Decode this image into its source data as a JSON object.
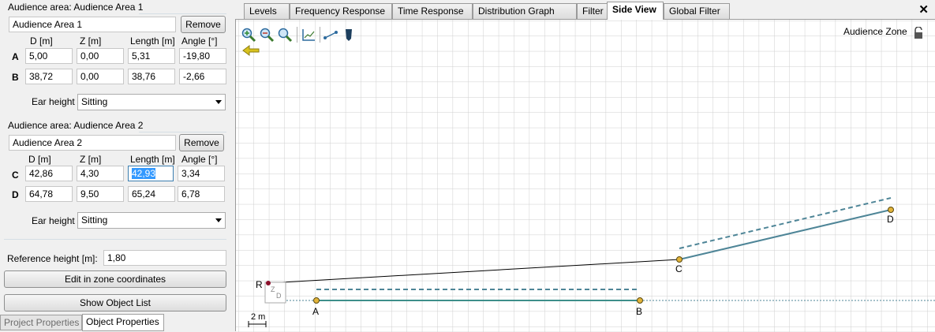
{
  "area1": {
    "title": "Audience area: Audience Area 1",
    "name": "Audience Area 1",
    "remove_label": "Remove",
    "columns": [
      "D [m]",
      "Z [m]",
      "Length [m]",
      "Angle [°]"
    ],
    "rows": [
      {
        "label": "A",
        "d": "5,00",
        "z": "0,00",
        "length": "5,31",
        "angle": "-19,80"
      },
      {
        "label": "B",
        "d": "38,72",
        "z": "0,00",
        "length": "38,76",
        "angle": "-2,66"
      }
    ],
    "ear_height_label": "Ear height",
    "ear_height_value": "Sitting"
  },
  "area2": {
    "title": "Audience area: Audience Area 2",
    "name": "Audience Area 2",
    "remove_label": "Remove",
    "columns": [
      "D [m]",
      "Z [m]",
      "Length [m]",
      "Angle [°]"
    ],
    "rows": [
      {
        "label": "C",
        "d": "42,86",
        "z": "4,30",
        "length": "42,93",
        "angle": "3,34"
      },
      {
        "label": "D",
        "d": "64,78",
        "z": "9,50",
        "length": "65,24",
        "angle": "6,78"
      }
    ],
    "ear_height_label": "Ear height",
    "ear_height_value": "Sitting"
  },
  "reference": {
    "label": "Reference height [m]:",
    "value": "1,80"
  },
  "buttons": {
    "edit_zone": "Edit in zone coordinates",
    "show_list": "Show Object List"
  },
  "bottom_tabs": [
    "Project Properties",
    "Object Properties"
  ],
  "tabs": [
    "Levels",
    "Frequency Response",
    "Time Response",
    "Distribution Graph",
    "Filter",
    "Side View",
    "Global Filter"
  ],
  "active_tab": "Side View",
  "close_glyph": "✕",
  "plot": {
    "zone_label": "Audience Zone",
    "point_labels": {
      "A": "A",
      "B": "B",
      "C": "C",
      "D": "D",
      "R": "R"
    },
    "scale_label": "2 m",
    "origin_z": "Z",
    "origin_d": "D"
  },
  "colors": {
    "audience_line": "#4e8597",
    "area1_line": "#3d8f8a",
    "point_fill": "#e3b43a",
    "grid": "#cfcfcf"
  },
  "icons": [
    "zoom-in-icon",
    "zoom-out-icon",
    "zoom-fit-icon",
    "axes-icon",
    "line-tool-icon",
    "speaker-icon",
    "back-arrow-icon",
    "lock-icon"
  ]
}
